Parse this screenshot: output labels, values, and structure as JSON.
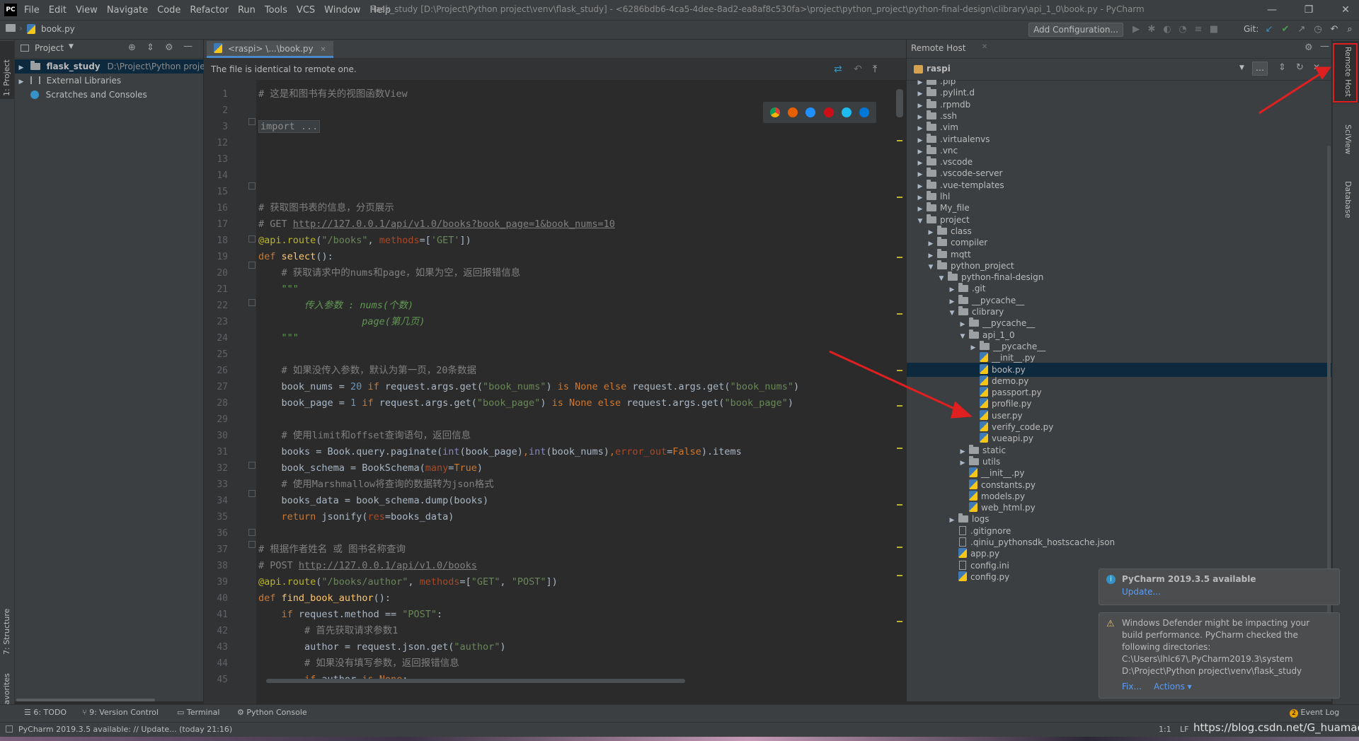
{
  "titlebar": {
    "menu": [
      "File",
      "Edit",
      "View",
      "Navigate",
      "Code",
      "Refactor",
      "Run",
      "Tools",
      "VCS",
      "Window",
      "Help"
    ],
    "title": "flask_study [D:\\Project\\Python project\\venv\\flask_study] - <6286bdb6-4ca5-4dee-8ad2-ea8af8c530fa>\\project\\python_project\\python-final-design\\clibrary\\api_1_0\\book.py - PyCharm"
  },
  "navbar": {
    "breadcrumb_file": "book.py",
    "add_config": "Add Configuration...",
    "git_label": "Git:"
  },
  "left_stripe": {
    "project_tab": "1: Project",
    "structure_tab": "7: Structure",
    "favorites_tab": "2: Favorites"
  },
  "project_panel": {
    "title": "Project",
    "items": [
      {
        "name": "flask_study",
        "path": "D:\\Project\\Python project\\"
      },
      {
        "name": "External Libraries"
      },
      {
        "name": "Scratches and Consoles"
      }
    ]
  },
  "editor": {
    "tab_label": "<raspi> \\...\\book.py",
    "notice": "The file is identical to remote one.",
    "line_numbers": [
      "1",
      "2",
      "3",
      "12",
      "13",
      "14",
      "15",
      "16",
      "17",
      "18",
      "19",
      "20",
      "21",
      "22",
      "23",
      "24",
      "25",
      "26",
      "27",
      "28",
      "29",
      "30",
      "31",
      "32",
      "33",
      "34",
      "35",
      "36",
      "37",
      "38",
      "39",
      "40",
      "41",
      "42",
      "43",
      "44",
      "45"
    ]
  },
  "remote_panel": {
    "title": "Remote Host",
    "host": "raspi",
    "tree": [
      {
        "label": ".pip",
        "type": "folder",
        "depth": 0,
        "arrow": "▶"
      },
      {
        "label": ".pylint.d",
        "type": "folder",
        "depth": 0,
        "arrow": "▶"
      },
      {
        "label": ".rpmdb",
        "type": "folder",
        "depth": 0,
        "arrow": "▶"
      },
      {
        "label": ".ssh",
        "type": "folder",
        "depth": 0,
        "arrow": "▶"
      },
      {
        "label": ".vim",
        "type": "folder",
        "depth": 0,
        "arrow": "▶"
      },
      {
        "label": ".virtualenvs",
        "type": "folder",
        "depth": 0,
        "arrow": "▶"
      },
      {
        "label": ".vnc",
        "type": "folder",
        "depth": 0,
        "arrow": "▶"
      },
      {
        "label": ".vscode",
        "type": "folder",
        "depth": 0,
        "arrow": "▶"
      },
      {
        "label": ".vscode-server",
        "type": "folder",
        "depth": 0,
        "arrow": "▶"
      },
      {
        "label": ".vue-templates",
        "type": "folder",
        "depth": 0,
        "arrow": "▶"
      },
      {
        "label": "lhl",
        "type": "folder",
        "depth": 0,
        "arrow": "▶"
      },
      {
        "label": "My_file",
        "type": "folder",
        "depth": 0,
        "arrow": "▶"
      },
      {
        "label": "project",
        "type": "folder",
        "depth": 0,
        "arrow": "▼"
      },
      {
        "label": "class",
        "type": "folder",
        "depth": 1,
        "arrow": "▶"
      },
      {
        "label": "compiler",
        "type": "folder",
        "depth": 1,
        "arrow": "▶"
      },
      {
        "label": "mqtt",
        "type": "folder",
        "depth": 1,
        "arrow": "▶"
      },
      {
        "label": "python_project",
        "type": "folder",
        "depth": 1,
        "arrow": "▼"
      },
      {
        "label": "python-final-design",
        "type": "folder",
        "depth": 2,
        "arrow": "▼"
      },
      {
        "label": ".git",
        "type": "folder",
        "depth": 3,
        "arrow": "▶"
      },
      {
        "label": "__pycache__",
        "type": "folder",
        "depth": 3,
        "arrow": "▶"
      },
      {
        "label": "clibrary",
        "type": "folder",
        "depth": 3,
        "arrow": "▼"
      },
      {
        "label": "__pycache__",
        "type": "folder",
        "depth": 4,
        "arrow": "▶"
      },
      {
        "label": "api_1_0",
        "type": "folder",
        "depth": 4,
        "arrow": "▼"
      },
      {
        "label": "__pycache__",
        "type": "folder",
        "depth": 5,
        "arrow": "▶"
      },
      {
        "label": "__init__.py",
        "type": "py",
        "depth": 5,
        "arrow": ""
      },
      {
        "label": "book.py",
        "type": "py",
        "depth": 5,
        "arrow": "",
        "selected": true
      },
      {
        "label": "demo.py",
        "type": "py",
        "depth": 5,
        "arrow": ""
      },
      {
        "label": "passport.py",
        "type": "py",
        "depth": 5,
        "arrow": ""
      },
      {
        "label": "profile.py",
        "type": "py",
        "depth": 5,
        "arrow": ""
      },
      {
        "label": "user.py",
        "type": "py",
        "depth": 5,
        "arrow": ""
      },
      {
        "label": "verify_code.py",
        "type": "py",
        "depth": 5,
        "arrow": ""
      },
      {
        "label": "vueapi.py",
        "type": "py",
        "depth": 5,
        "arrow": ""
      },
      {
        "label": "static",
        "type": "folder",
        "depth": 4,
        "arrow": "▶"
      },
      {
        "label": "utils",
        "type": "folder",
        "depth": 4,
        "arrow": "▶"
      },
      {
        "label": "__init__.py",
        "type": "py",
        "depth": 4,
        "arrow": ""
      },
      {
        "label": "constants.py",
        "type": "py",
        "depth": 4,
        "arrow": ""
      },
      {
        "label": "models.py",
        "type": "py",
        "depth": 4,
        "arrow": ""
      },
      {
        "label": "web_html.py",
        "type": "py",
        "depth": 4,
        "arrow": ""
      },
      {
        "label": "logs",
        "type": "folder",
        "depth": 3,
        "arrow": "▶"
      },
      {
        "label": ".gitignore",
        "type": "file",
        "depth": 3,
        "arrow": ""
      },
      {
        "label": ".qiniu_pythonsdk_hostscache.json",
        "type": "file",
        "depth": 3,
        "arrow": ""
      },
      {
        "label": "app.py",
        "type": "py",
        "depth": 3,
        "arrow": ""
      },
      {
        "label": "config.ini",
        "type": "file",
        "depth": 3,
        "arrow": ""
      },
      {
        "label": "config.py",
        "type": "py",
        "depth": 3,
        "arrow": ""
      }
    ]
  },
  "right_stripe": {
    "remote_host_tab": "Remote Host",
    "sciview_tab": "SciView",
    "database_tab": "Database"
  },
  "notifications": {
    "update": {
      "title": "PyCharm 2019.3.5 available",
      "link": "Update..."
    },
    "defender": {
      "line1": "Windows Defender might be impacting your",
      "line2": "build performance. PyCharm checked the",
      "line3": "following directories:",
      "line4": "C:\\Users\\lhlc67\\.PyCharm2019.3\\system",
      "line5": "D:\\Project\\Python project\\venv\\flask_study",
      "fix": "Fix...",
      "actions": "Actions ▾"
    }
  },
  "bottom_bar": {
    "todo": "6: TODO",
    "vcs": "9: Version Control",
    "terminal": "Terminal",
    "console": "Python Console",
    "event_log": "Event Log",
    "event_count": "2"
  },
  "statusbar": {
    "message": "PyCharm 2019.3.5 available: // Update... (today 21:16)",
    "position": "1:1",
    "line_sep": "LF",
    "watermark": "https://blog.csdn.net/G_huamao"
  },
  "colors": {
    "accent": "#4a88c7",
    "selection": "#0d293e",
    "annotation": "#e02020"
  }
}
